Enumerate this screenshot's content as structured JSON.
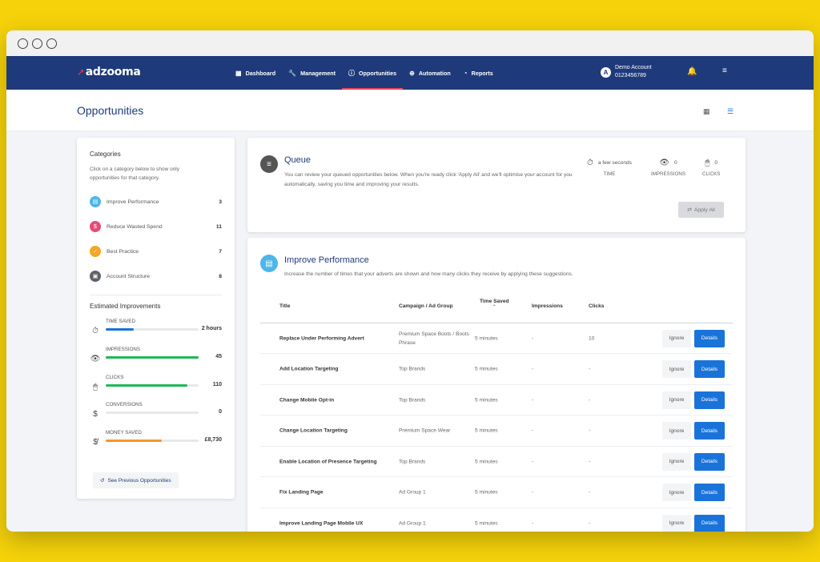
{
  "window": {
    "controls": [
      "close",
      "minimize",
      "maximize"
    ]
  },
  "brand": {
    "logo_text": "adzooma"
  },
  "nav": {
    "items": [
      {
        "label": "Dashboard",
        "icon": "grid-icon",
        "active": false
      },
      {
        "label": "Management",
        "icon": "wrench-icon",
        "active": false
      },
      {
        "label": "Opportunities",
        "icon": "info-icon",
        "active": true
      },
      {
        "label": "Automation",
        "icon": "plus-circle-icon",
        "active": false
      },
      {
        "label": "Reports",
        "icon": "pie-chart-icon",
        "active": false
      }
    ],
    "account": {
      "avatar_letter": "A",
      "name": "Demo Account",
      "id": "0123456789"
    }
  },
  "page": {
    "title": "Opportunities"
  },
  "sidebar": {
    "heading": "Categories",
    "description": "Click on a category below to show only opportunities for that category.",
    "categories": [
      {
        "label": "Improve Performance",
        "count": "3",
        "color": "#4db6e8"
      },
      {
        "label": "Reduce Wasted Spend",
        "count": "11",
        "color": "#e84a78"
      },
      {
        "label": "Best Practice",
        "count": "7",
        "color": "#f5a623"
      },
      {
        "label": "Account Structure",
        "count": "8",
        "color": "#5f6368"
      }
    ],
    "estimated_heading": "Estimated Improvements",
    "metrics": [
      {
        "label": "TIME SAVED",
        "value": "2 hours",
        "icon": "stopwatch-icon",
        "fill": 0.3,
        "color": "#1a73d9"
      },
      {
        "label": "IMPRESSIONS",
        "value": "45",
        "icon": "eye-icon",
        "fill": 1.0,
        "color": "#1db954"
      },
      {
        "label": "CLICKS",
        "value": "110",
        "icon": "mouse-icon",
        "fill": 0.88,
        "color": "#1db954"
      },
      {
        "label": "CONVERSIONS",
        "value": "0",
        "icon": "dollar-icon",
        "fill": 0.0,
        "color": "#1db954"
      },
      {
        "label": "MONEY SAVED",
        "value": "£8,730",
        "icon": "no-dollar-icon",
        "fill": 0.6,
        "color": "#f5952b"
      }
    ],
    "prev_button": "See Previous Opportunities"
  },
  "queue": {
    "title": "Queue",
    "description": "You can review your queued opportunities below. When you're ready click 'Apply All' and we'll optimise your account for you automatically, saving you time and improving your results.",
    "stats": [
      {
        "value": "a few seconds",
        "label": "TIME",
        "icon": "stopwatch-icon"
      },
      {
        "value": "0",
        "label": "IMPRESSIONS",
        "icon": "eye-icon"
      },
      {
        "value": "0",
        "label": "CLICKS",
        "icon": "mouse-icon"
      }
    ],
    "apply_button": "Apply All"
  },
  "improve": {
    "title": "Improve Performance",
    "description": "Increase the number of times that your adverts are shown and how many clicks they receive by applying these suggestions.",
    "columns": [
      "Title",
      "Campaign / Ad Group",
      "Time Saved",
      "Impressions",
      "Clicks"
    ],
    "ignore_label": "Ignore",
    "details_label": "Details",
    "rows": [
      {
        "title": "Replace Under Performing Advert",
        "campaign": "Premium Space Boots / Boots Phrase",
        "time": "5 minutes",
        "impressions": "-",
        "clicks": "10"
      },
      {
        "title": "Add Location Targeting",
        "campaign": "Top Brands",
        "time": "5 minutes",
        "impressions": "-",
        "clicks": "-"
      },
      {
        "title": "Change Mobile Opt-in",
        "campaign": "Top Brands",
        "time": "5 minutes",
        "impressions": "-",
        "clicks": "-"
      },
      {
        "title": "Change Location Targeting",
        "campaign": "Premium Space Wear",
        "time": "5 minutes",
        "impressions": "-",
        "clicks": "-"
      },
      {
        "title": "Enable Location of Presence Targeting",
        "campaign": "Top Brands",
        "time": "5 minutes",
        "impressions": "-",
        "clicks": "-"
      },
      {
        "title": "Fix Landing Page",
        "campaign": "Ad Group 1",
        "time": "5 minutes",
        "impressions": "-",
        "clicks": "-"
      },
      {
        "title": "Improve Landing Page Mobile UX",
        "campaign": "Ad Group 1",
        "time": "5 minutes",
        "impressions": "-",
        "clicks": "-"
      }
    ]
  }
}
